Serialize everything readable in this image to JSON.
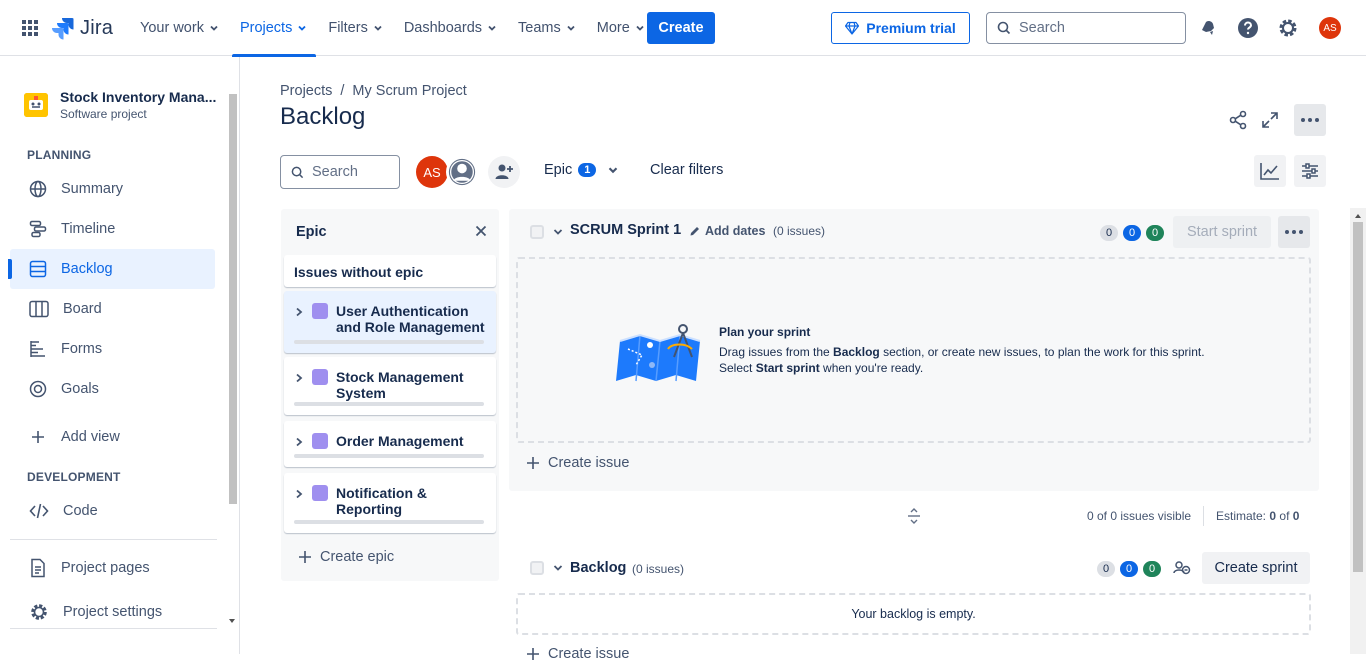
{
  "topnav": {
    "logo": "Jira",
    "items": [
      {
        "label": "Your work"
      },
      {
        "label": "Projects"
      },
      {
        "label": "Filters"
      },
      {
        "label": "Dashboards"
      },
      {
        "label": "Teams"
      },
      {
        "label": "More"
      }
    ],
    "active_item": "Projects",
    "create_label": "Create",
    "premium_label": "Premium trial",
    "search_placeholder": "Search",
    "avatar_initials": "AS"
  },
  "sidebar": {
    "project_name": "Stock Inventory Mana...",
    "project_type": "Software project",
    "planning_header": "PLANNING",
    "planning_items": [
      "Summary",
      "Timeline",
      "Backlog",
      "Board",
      "Forms",
      "Goals"
    ],
    "active_item": "Backlog",
    "add_view": "Add view",
    "development_header": "DEVELOPMENT",
    "code": "Code",
    "project_pages": "Project pages",
    "project_settings": "Project settings"
  },
  "main": {
    "breadcrumb": [
      "Projects",
      "My Scrum Project"
    ],
    "breadcrumb_sep": "/",
    "title": "Backlog",
    "search_placeholder": "Search",
    "avatar_initials": "AS",
    "epic_filter": {
      "label": "Epic",
      "count": "1"
    },
    "clear_filters": "Clear filters"
  },
  "epic_panel": {
    "title": "Epic",
    "issues_without_epic": "Issues without epic",
    "epics": [
      {
        "name": "User Authentication and Role Management",
        "selected": true
      },
      {
        "name": "Stock Management System",
        "selected": false
      },
      {
        "name": "Order Management",
        "selected": false
      },
      {
        "name": "Notification & Reporting",
        "selected": false
      }
    ],
    "create_epic": "Create epic",
    "epic_color": "#9f8fef"
  },
  "sprint": {
    "name": "SCRUM Sprint 1",
    "add_dates": "Add dates",
    "issue_count": "(0 issues)",
    "counts": {
      "todo": "0",
      "in_progress": "0",
      "done": "0"
    },
    "start_label": "Start sprint",
    "plan_title": "Plan your sprint",
    "plan_line1_pre": "Drag issues from the ",
    "plan_line1_bold": "Backlog",
    "plan_line1_post": " section, or create new issues, to plan the work for this sprint.",
    "plan_line2_pre": "Select ",
    "plan_line2_bold": "Start sprint",
    "plan_line2_post": " when you're ready.",
    "create_issue": "Create issue"
  },
  "summary": {
    "visible": "0 of 0 issues visible",
    "estimate_label": "Estimate:",
    "estimate_value": "0",
    "estimate_of": "of",
    "estimate_total": "0"
  },
  "backlog": {
    "name": "Backlog",
    "issue_count": "(0 issues)",
    "counts": {
      "todo": "0",
      "in_progress": "0",
      "done": "0"
    },
    "create_sprint": "Create sprint",
    "empty_text": "Your backlog is empty.",
    "create_issue": "Create issue"
  },
  "colors": {
    "accent": "#0c66e4",
    "avatar": "#de350b",
    "done": "#1f845a"
  }
}
